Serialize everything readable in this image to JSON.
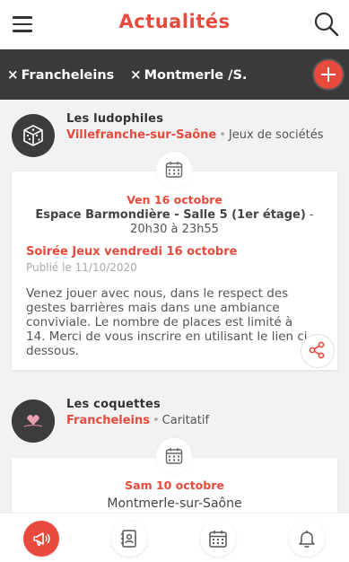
{
  "header": {
    "title": "Actualités",
    "menu_icon": "hamburger-menu-icon",
    "search_icon": "search-icon"
  },
  "filters": {
    "chips": [
      "Francheleins",
      "Montmerle /S."
    ],
    "remove_symbol": "×",
    "add_icon": "plus-icon"
  },
  "colors": {
    "accent": "#e84a3d",
    "filter_bar": "#3a3a3a",
    "background": "#f2f2f2"
  },
  "posts": [
    {
      "organizer": {
        "name": "Les ludophiles",
        "city": "Villefranche-sur-Saône",
        "separator": "•",
        "category": "Jeux de sociétés",
        "avatar_icon": "dice-icon"
      },
      "event": {
        "date": "Ven 16 octobre",
        "place": "Espace Barmondière - Salle 5 (1er étage)",
        "time": "- 20h30 à 23h55",
        "title": "Soirée Jeux vendredi 16 octobre",
        "published": "Publié le 11/10/2020",
        "description": "Venez jouer avec nous, dans le respect des gestes barrières mais dans une ambiance conviviale. Le nombre de places est limité à 14. Merci de vous inscrire en utilisant le lien ci-dessous."
      }
    },
    {
      "organizer": {
        "name": "Les coquettes",
        "city": "Francheleins",
        "separator": "•",
        "category": "Caritatif",
        "avatar_icon": "coquettes-logo"
      },
      "event": {
        "date": "Sam 10 octobre",
        "place": "Montmerle-sur-Saône"
      }
    }
  ],
  "bottom_nav": [
    {
      "icon": "megaphone-icon",
      "active": true
    },
    {
      "icon": "contacts-book-icon",
      "active": false
    },
    {
      "icon": "calendar-icon",
      "active": false
    },
    {
      "icon": "bell-icon",
      "active": false
    }
  ]
}
